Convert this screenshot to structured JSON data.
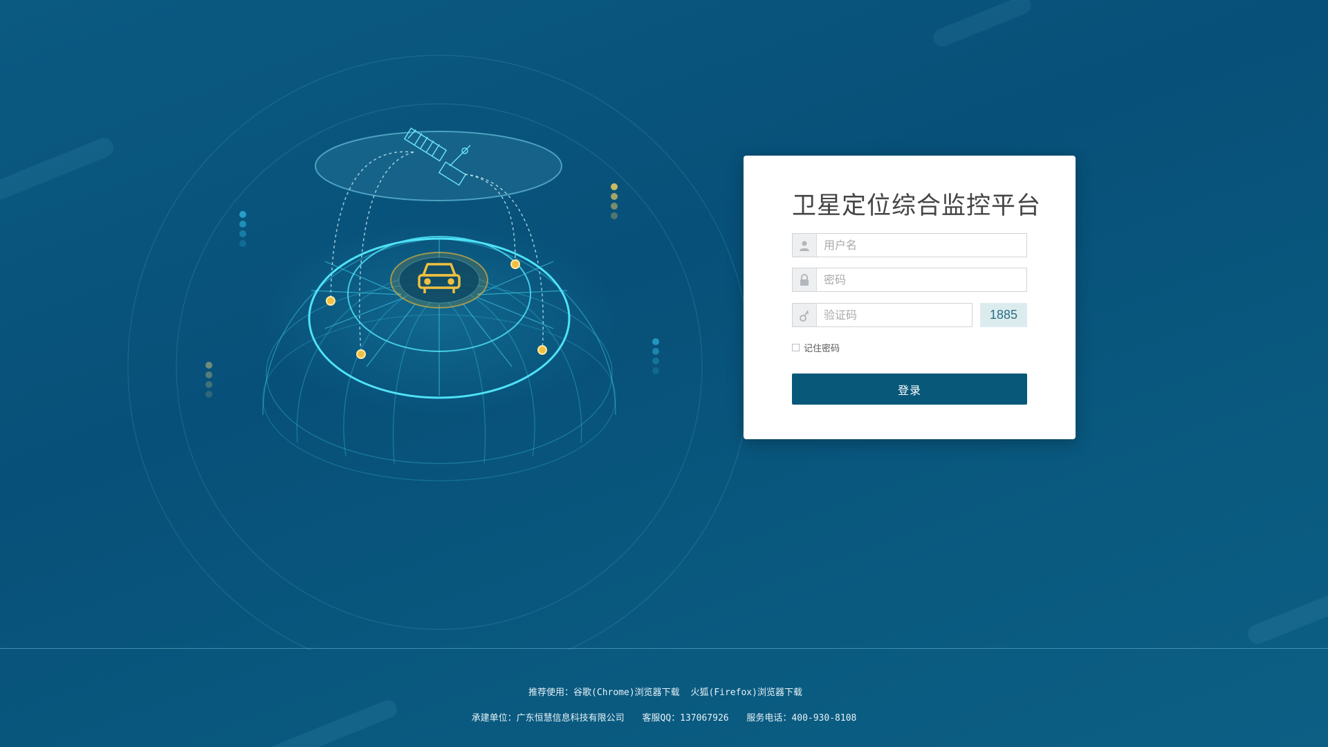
{
  "login": {
    "title": "卫星定位综合监控平台",
    "username_placeholder": "用户名",
    "password_placeholder": "密码",
    "captcha_placeholder": "验证码",
    "captcha_code": "1885",
    "remember_label": "记住密码",
    "submit_label": "登录"
  },
  "footer": {
    "recommend_prefix": "推荐使用：",
    "chrome_link": "谷歌(Chrome)浏览器下载",
    "firefox_link": "火狐(Firefox)浏览器下载",
    "company": "承建单位：广东恒慧信息科技有限公司",
    "qq": "客服QQ：137067926",
    "phone": "服务电话：400-930-8108"
  },
  "icons": {
    "username": "user-icon",
    "password": "lock-icon",
    "captcha": "key-icon",
    "center": "car-icon",
    "orbit": "satellite-icon"
  },
  "colors": {
    "background": "#075079",
    "card": "#ffffff",
    "button": "#08587a",
    "accent_gold": "#f0c040",
    "accent_cyan": "#3fd6f0"
  }
}
